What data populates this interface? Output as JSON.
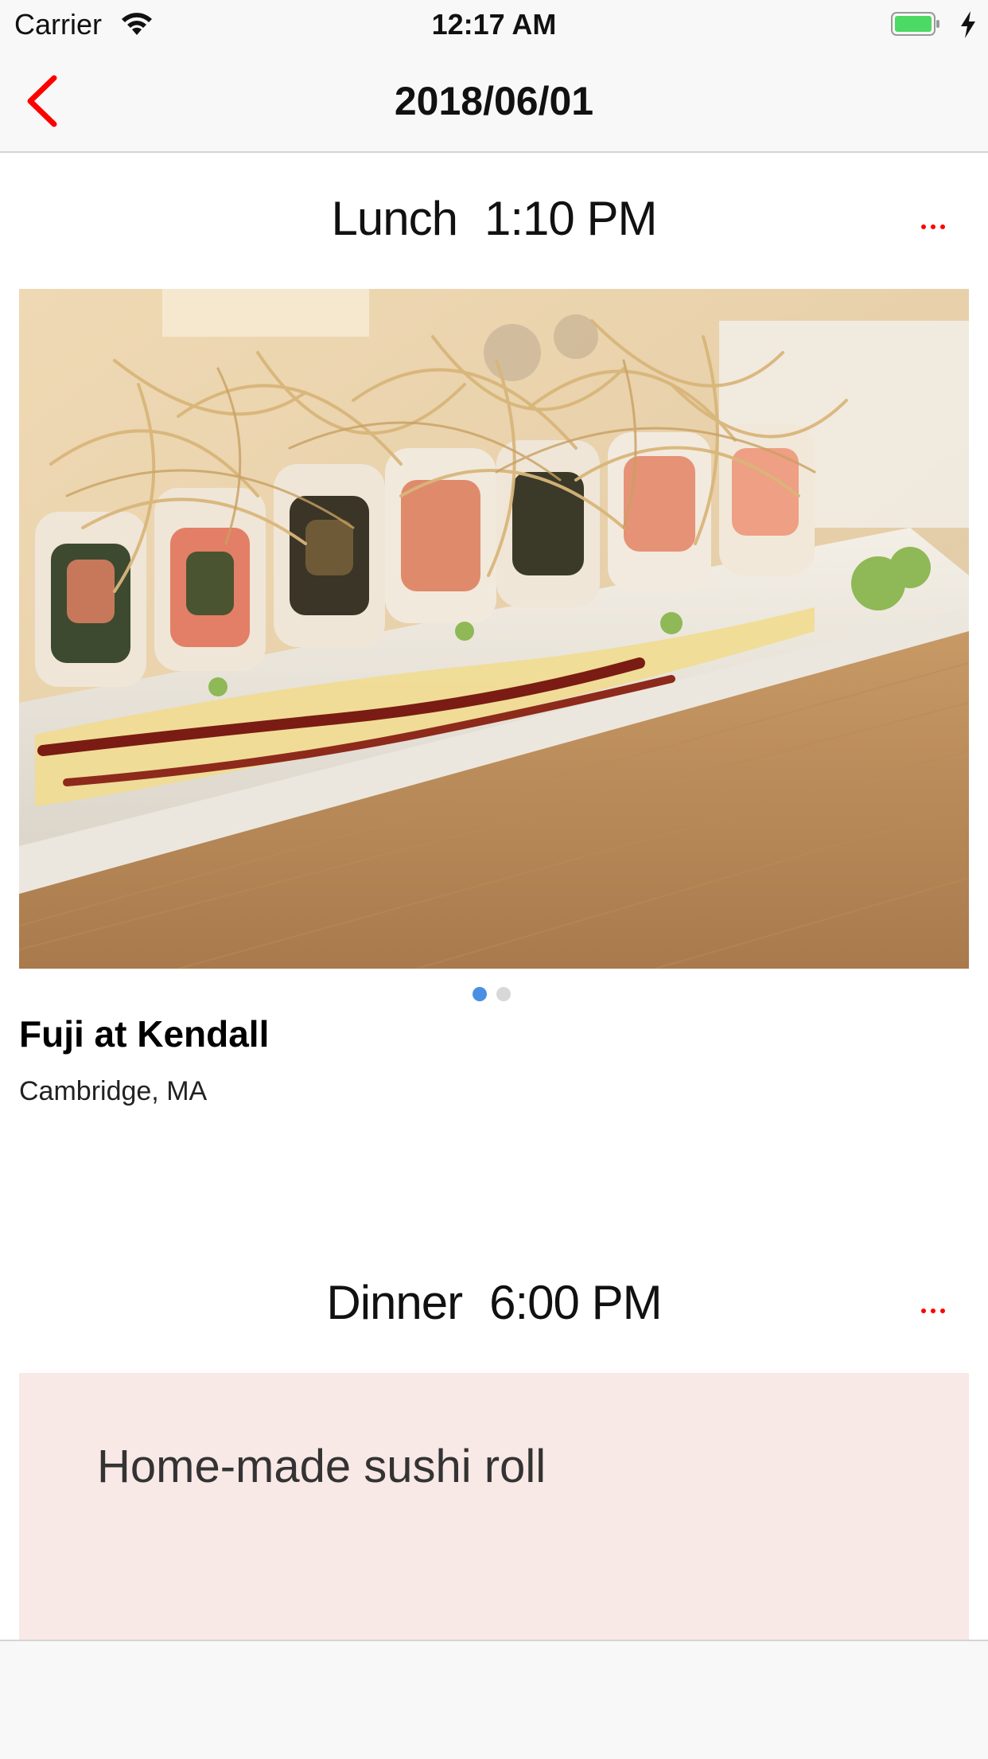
{
  "status_bar": {
    "carrier": "Carrier",
    "time": "12:17 AM"
  },
  "nav": {
    "title": "2018/06/01"
  },
  "colors": {
    "accent": "#ff0000",
    "page_dot_active": "#4a90e2",
    "page_dot_inactive": "#d8d8d8",
    "note_background": "#f8e8e6",
    "battery": "#4cd964"
  },
  "meals": [
    {
      "label": "Lunch",
      "time": "1:10 PM",
      "place_name": "Fuji at Kendall",
      "place_location": "Cambridge, MA",
      "photo_count": 2,
      "photo_index": 1
    },
    {
      "label": "Dinner",
      "time": "6:00 PM",
      "note": "Home-made sushi roll"
    }
  ],
  "icons": {
    "back": "chevron-left-icon",
    "more": "ellipsis-icon",
    "wifi": "wifi-icon",
    "battery": "battery-icon",
    "charging": "lightning-bolt-icon"
  }
}
